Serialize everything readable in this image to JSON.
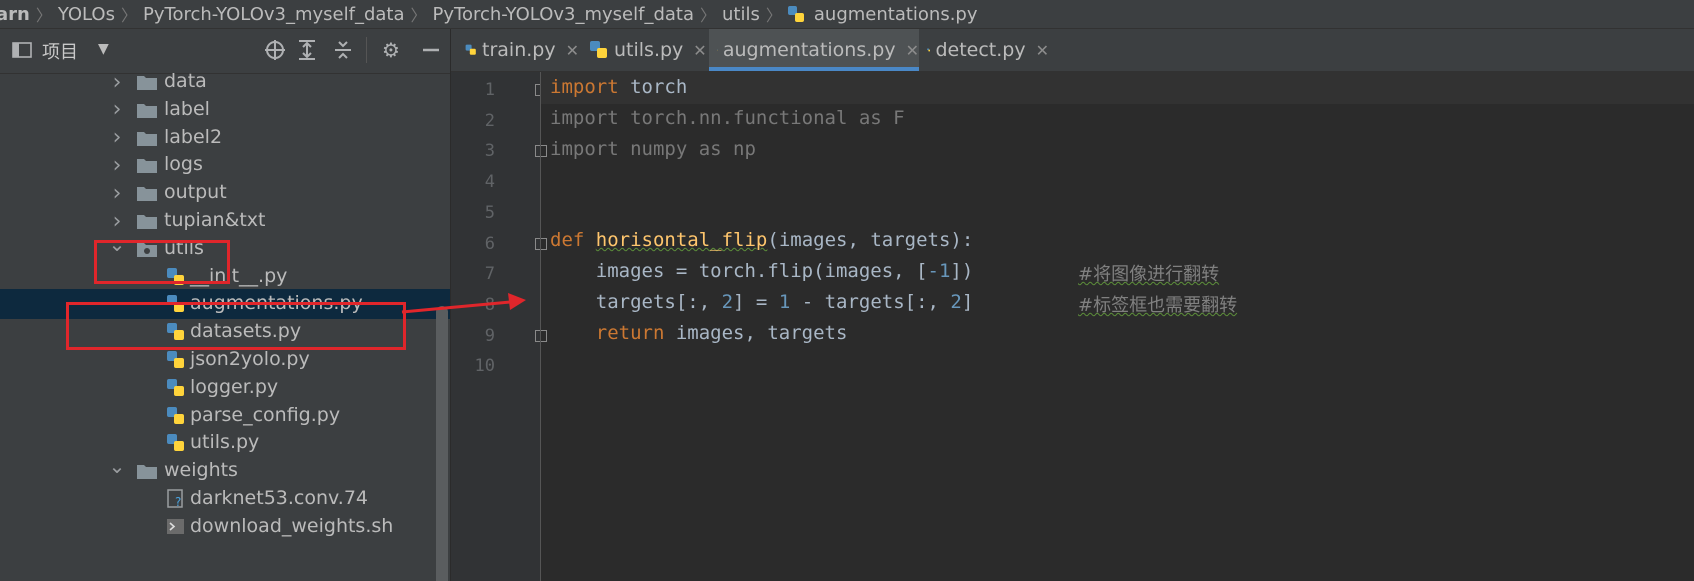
{
  "breadcrumb": [
    "arn",
    "YOLOs",
    "PyTorch-YOLOv3_myself_data",
    "PyTorch-YOLOv3_myself_data",
    "utils",
    "augmentations.py"
  ],
  "project_panel": {
    "title": "项目",
    "icons": [
      "target-icon",
      "expand-all-icon",
      "collapse-all-icon",
      "gear-icon",
      "minimize-icon"
    ]
  },
  "tree": [
    {
      "label": "data",
      "type": "folder",
      "expanded": false
    },
    {
      "label": "label",
      "type": "folder",
      "expanded": false
    },
    {
      "label": "label2",
      "type": "folder",
      "expanded": false
    },
    {
      "label": "logs",
      "type": "folder",
      "expanded": false
    },
    {
      "label": "output",
      "type": "folder",
      "expanded": false
    },
    {
      "label": "tupian&txt",
      "type": "folder",
      "expanded": false
    },
    {
      "label": "utils",
      "type": "package",
      "expanded": true
    },
    {
      "label": "__init__.py",
      "type": "python"
    },
    {
      "label": "augmentations.py",
      "type": "python",
      "selected": true
    },
    {
      "label": "datasets.py",
      "type": "python"
    },
    {
      "label": "json2yolo.py",
      "type": "python"
    },
    {
      "label": "logger.py",
      "type": "python"
    },
    {
      "label": "parse_config.py",
      "type": "python"
    },
    {
      "label": "utils.py",
      "type": "python"
    },
    {
      "label": "weights",
      "type": "folder",
      "expanded": true
    },
    {
      "label": "darknet53.conv.74",
      "type": "unknown"
    },
    {
      "label": "download_weights.sh",
      "type": "shell"
    }
  ],
  "tabs": [
    {
      "label": "train.py",
      "active": false
    },
    {
      "label": "utils.py",
      "active": false
    },
    {
      "label": "augmentations.py",
      "active": true
    },
    {
      "label": "detect.py",
      "active": false
    }
  ],
  "tab_close": "✕",
  "line_numbers": [
    "1",
    "2",
    "3",
    "4",
    "5",
    "6",
    "7",
    "8",
    "9",
    "10"
  ],
  "code": {
    "l1": {
      "kw": "import",
      "rest": " torch"
    },
    "l2": "import torch.nn.functional as F",
    "l3": "import numpy as np",
    "l6": {
      "kw": "def",
      "fn": "horisontal_flip",
      "rest": "(images, targets):"
    },
    "l7": {
      "a": "    images = torch.flip(images, [",
      "num": "-1",
      "b": "])",
      "comment": "#将图像进行翻转"
    },
    "l8": {
      "a": "    targets[:, ",
      "num1": "2",
      "b": "] = ",
      "num2": "1",
      "c": " - targets[:, ",
      "num3": "2",
      "d": "]",
      "comment": "#标签框也需要翻转"
    },
    "l9": {
      "kw": "return",
      "rest": " images, targets"
    }
  },
  "colors": {
    "annotation": "#e0262b",
    "keyword": "#cc7832",
    "function": "#ffc66d",
    "number": "#6897bb",
    "comment": "#808080"
  }
}
